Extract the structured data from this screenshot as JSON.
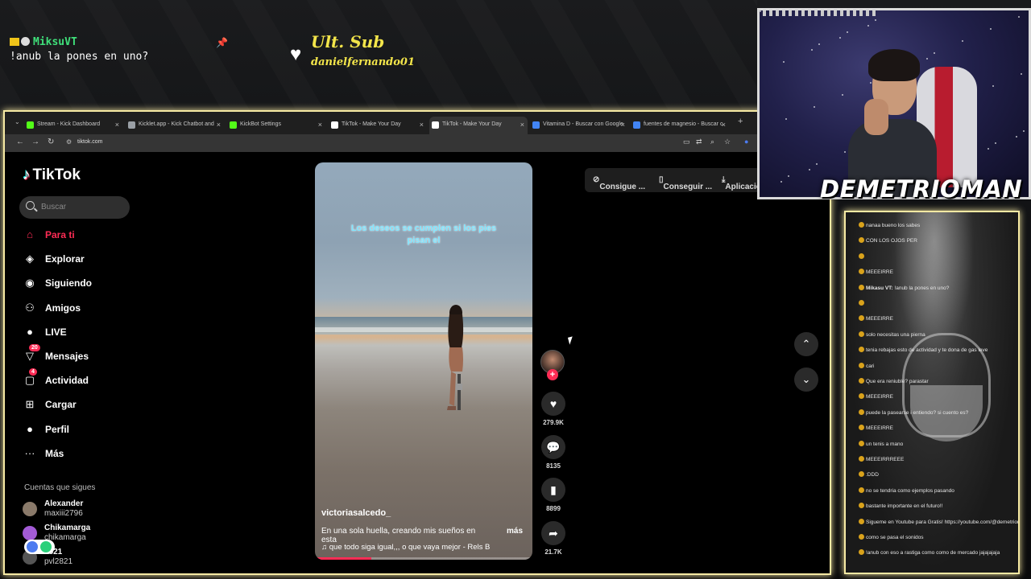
{
  "top_chat": {
    "user": "MiksuVT",
    "message": "!anub la pones en uno?"
  },
  "last_sub": {
    "label": "Ult. Sub",
    "name": "danielfernando01"
  },
  "browser": {
    "tabs": [
      {
        "title": "Stream - Kick Dashboard",
        "color": "#53fc18"
      },
      {
        "title": "Kicklet.app - Kick Chatbot and",
        "color": "#9aa0a6"
      },
      {
        "title": "KickBot Settings",
        "color": "#53fc18"
      },
      {
        "title": "TikTok - Make Your Day",
        "color": "#ffffff"
      },
      {
        "title": "TikTok - Make Your Day",
        "color": "#ffffff"
      },
      {
        "title": "Vitamina D - Buscar con Google",
        "color": "#4285f4"
      },
      {
        "title": "fuentes de magnesio - Buscar c",
        "color": "#4285f4"
      }
    ],
    "url": "tiktok.com"
  },
  "tiktok": {
    "logo": "TikTok",
    "search_placeholder": "Buscar",
    "nav": [
      {
        "label": "Para ti",
        "icon": "home-icon",
        "active": true
      },
      {
        "label": "Explorar",
        "icon": "compass-icon"
      },
      {
        "label": "Siguiendo",
        "icon": "following-icon"
      },
      {
        "label": "Amigos",
        "icon": "friends-icon"
      },
      {
        "label": "LIVE",
        "icon": "live-icon"
      },
      {
        "label": "Mensajes",
        "icon": "messages-icon",
        "badge": "20"
      },
      {
        "label": "Actividad",
        "icon": "activity-icon",
        "badge": "4"
      },
      {
        "label": "Cargar",
        "icon": "upload-icon"
      },
      {
        "label": "Perfil",
        "icon": "profile-icon"
      },
      {
        "label": "Más",
        "icon": "more-icon"
      }
    ],
    "following_header": "Cuentas que sigues",
    "following": [
      {
        "name": "Alexander",
        "handle": "maxiii2796"
      },
      {
        "name": "Chikamarga",
        "handle": "chikamarga"
      },
      {
        "name": "2821",
        "handle": "pvl2821"
      }
    ],
    "top_buttons": [
      "Consigue ...",
      "Conseguir ...",
      "Aplicación"
    ],
    "video": {
      "caption": "Los deseos se cumplen si los pies pisan el",
      "username": "victoriasalcedo_",
      "description": "En una sola huella, creando mis sueños en esta",
      "more": "más",
      "music": "que todo siga igual,,, o que vaya mejor - Rels B",
      "progress": 0.26
    },
    "actions": {
      "likes": "279.9K",
      "comments": "8135",
      "saves": "8899",
      "shares": "21.7K"
    }
  },
  "webcam": {
    "name": "DEMETRIOMAN"
  },
  "chat_lines": [
    {
      "user": "",
      "text": "nanaa bueno los sabes"
    },
    {
      "user": "",
      "text": "CON LOS OJOS PER"
    },
    {
      "user": "",
      "text": ""
    },
    {
      "user": "",
      "text": "MEEEIRRE"
    },
    {
      "user": "Mikasu VT:",
      "text": "!anub la pones en uno?"
    },
    {
      "user": "",
      "text": ""
    },
    {
      "user": "",
      "text": "MEEEIRRE"
    },
    {
      "user": "",
      "text": "solo necesitas una pierna"
    },
    {
      "user": "",
      "text": "tenia rebajas esto de actividad y te dona de gas leve"
    },
    {
      "user": "",
      "text": "cari"
    },
    {
      "user": "",
      "text": "Que era reniuble? parastar"
    },
    {
      "user": "",
      "text": "MEEEIRRE"
    },
    {
      "user": "",
      "text": "puede la pasearse i entiendo? si cuento es?"
    },
    {
      "user": "",
      "text": "MEEEIRRE"
    },
    {
      "user": "",
      "text": "un tenis a mano"
    },
    {
      "user": "",
      "text": "MEEEIRRREEE"
    },
    {
      "user": "",
      "text": ":DDD"
    },
    {
      "user": "",
      "text": "no se tendria como ejemplos pasando"
    },
    {
      "user": "",
      "text": "bastante importante en el futuro!!"
    },
    {
      "user": "",
      "text": "Sigueme en Youtube para Gratis! https://youtube.com/@demetrioman"
    },
    {
      "user": "",
      "text": "como se pasa el sonidos"
    },
    {
      "user": "",
      "text": "!anub con eso a rastiga como como de mercado jajajajaja"
    }
  ]
}
